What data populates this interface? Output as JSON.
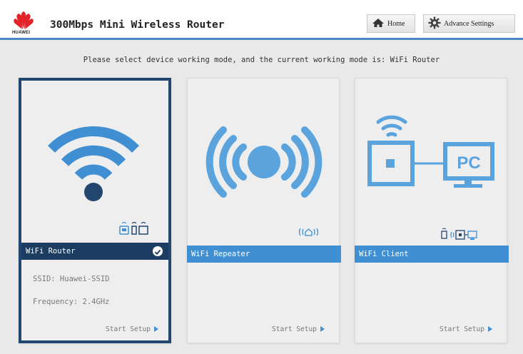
{
  "header": {
    "logo_text": "HUAWEI",
    "product_title": "300Mbps Mini Wireless Router",
    "home_label": "Home",
    "advance_settings_label": "Advance Settings"
  },
  "mode_message": "Please select device working mode, and the current working mode is: WiFi Router",
  "cards": [
    {
      "name": "WiFi Router",
      "selected": true,
      "ssid": "SSID: Huawei-SSID",
      "frequency": "Frequency: 2.4GHz",
      "action": "Start Setup"
    },
    {
      "name": "WiFi Repeater",
      "selected": false,
      "action": "Start Setup"
    },
    {
      "name": "WiFi Client",
      "selected": false,
      "action": "Start Setup"
    }
  ],
  "client_icon_pc_label": "PC",
  "colors": {
    "accent": "#3f8fd2",
    "selected_bar": "#1c3c62",
    "header_border": "#4a88c6",
    "icon_blue": "#5ba3dd",
    "brand_red": "#e3232a"
  }
}
